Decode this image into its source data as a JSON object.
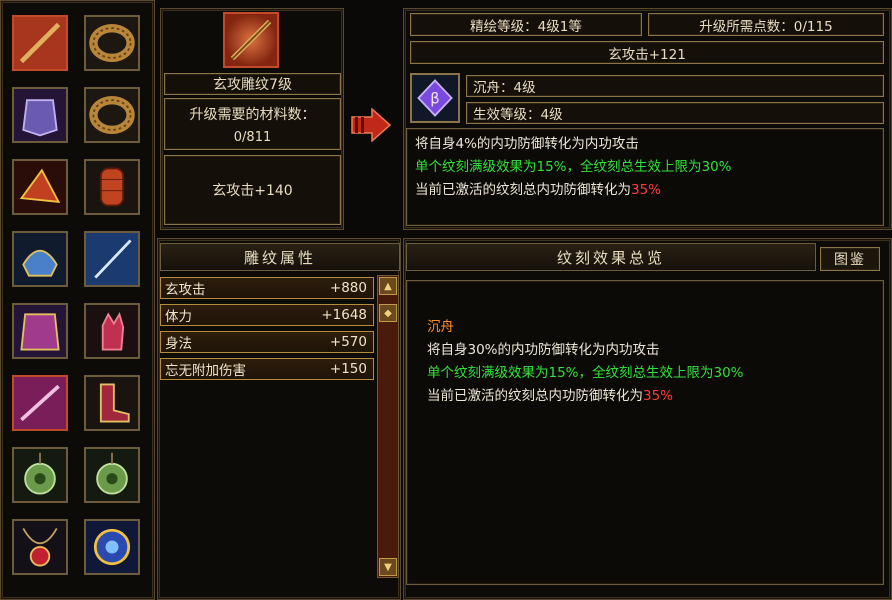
{
  "engrave": {
    "name": "玄攻雕纹7级",
    "material_label": "升级需要的材料数：",
    "material_value": "0/811",
    "stat_line": "玄攻击+140"
  },
  "upgrade": {
    "level_text": "精绘等级：4级1等",
    "points_text": "升级所需点数：0/115",
    "bonus_text": "玄攻击+121",
    "rune_name": "沉舟：4级",
    "effect_level": "生效等级：4级",
    "desc_white": "将自身4%的内功防御转化为内功攻击",
    "desc_green": "单个纹刻满级效果为15%，全纹刻总生效上限为30%",
    "desc_mixed_prefix": "当前已激活的纹刻总内功防御转化为",
    "desc_mixed_value": "35%"
  },
  "attributes": {
    "title": "雕纹属性",
    "rows": [
      {
        "name": "玄攻击",
        "value": "+880"
      },
      {
        "name": "体力",
        "value": "+1648"
      },
      {
        "name": "身法",
        "value": "+570"
      },
      {
        "name": "忘无附加伤害",
        "value": "+150"
      }
    ]
  },
  "overview": {
    "title": "纹刻效果总览",
    "button": "图鉴",
    "rune_name": "沉舟",
    "line1": "将自身30%的内功防御转化为内功攻击",
    "line2": "单个纹刻满级效果为15%，全纹刻总生效上限为30%",
    "line3_prefix": "当前已激活的纹刻总内功防御转化为",
    "line3_value": "35%"
  },
  "slots": [
    {
      "icon": "weapon-icon",
      "selected": true
    },
    {
      "icon": "ring-icon",
      "selected": false
    },
    {
      "icon": "armor-icon",
      "selected": false
    },
    {
      "icon": "ring-icon",
      "selected": false
    },
    {
      "icon": "shoulder-icon",
      "selected": false
    },
    {
      "icon": "bracer-icon",
      "selected": false
    },
    {
      "icon": "helmet-icon",
      "selected": false
    },
    {
      "icon": "blade-icon",
      "selected": false
    },
    {
      "icon": "cape-icon",
      "selected": false
    },
    {
      "icon": "glove-icon",
      "selected": false
    },
    {
      "icon": "dagger-icon",
      "selected": true
    },
    {
      "icon": "boots-icon",
      "selected": false
    },
    {
      "icon": "jade-pendant-icon",
      "selected": false
    },
    {
      "icon": "jade-pendant-icon",
      "selected": false
    },
    {
      "icon": "necklace-icon",
      "selected": false
    },
    {
      "icon": "amulet-icon",
      "selected": false
    }
  ],
  "colors": {
    "green_text": "#33e03a",
    "red_text": "#ff3c3c",
    "orange_text": "#ff8a2a",
    "border_gold": "#8a7448"
  }
}
